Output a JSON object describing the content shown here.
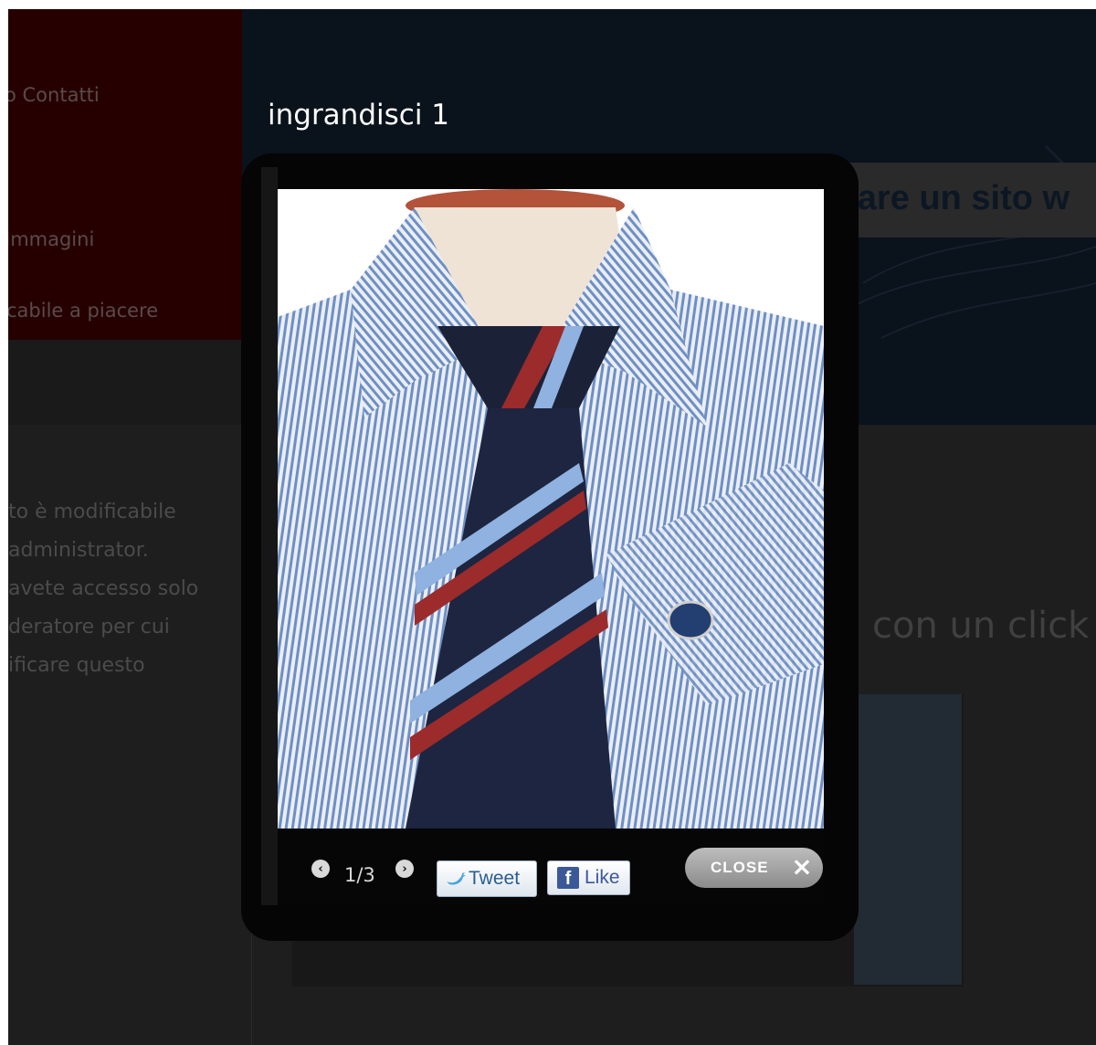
{
  "nav": {
    "items": [
      "o Contatti",
      "Immagini",
      "cabile a piacere"
    ]
  },
  "promo": {
    "text": "mare un sito w"
  },
  "side_text": {
    "lines": [
      "to è modificabile",
      "administrator.",
      "avete accesso solo",
      "deratore per cui",
      "ificare questo"
    ]
  },
  "content": {
    "heading": "con un click"
  },
  "lightbox": {
    "title": "ingrandisci 1",
    "counter": "1/3",
    "prev_icon": "chevron-left-circle-icon",
    "next_icon": "chevron-right-circle-icon",
    "tweet_label": "Tweet",
    "like_label": "Like",
    "close_label": "CLOSE",
    "close_icon": "close-icon"
  },
  "colors": {
    "overlay": "#1f1f1f",
    "lightbox_bg": "#050505",
    "nav_panel": "#260000",
    "facebook": "#3b5998",
    "twitter_text": "#2b5e8e"
  }
}
